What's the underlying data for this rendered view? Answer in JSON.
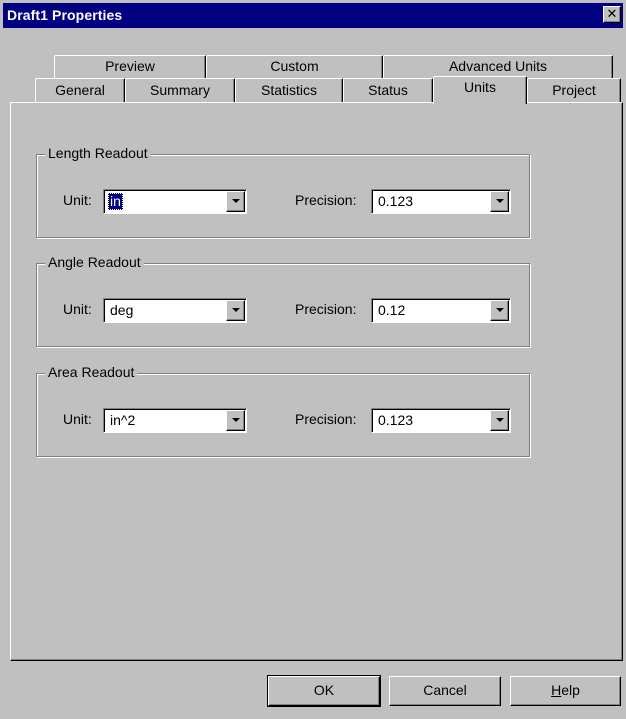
{
  "window": {
    "title": "Draft1 Properties",
    "close_glyph": "✕"
  },
  "tabs": {
    "row1": [
      "Preview",
      "Custom",
      "Advanced Units"
    ],
    "row2": [
      "General",
      "Summary",
      "Statistics",
      "Status",
      "Units",
      "Project"
    ],
    "active": "Units"
  },
  "groups": {
    "length": {
      "title": "Length Readout",
      "unit_label": "Unit:",
      "unit_value": "in",
      "precision_label": "Precision:",
      "precision_value": "0.123"
    },
    "angle": {
      "title": "Angle Readout",
      "unit_label": "Unit:",
      "unit_value": "deg",
      "precision_label": "Precision:",
      "precision_value": "0.12"
    },
    "area": {
      "title": "Area Readout",
      "unit_label": "Unit:",
      "unit_value": "in^2",
      "precision_label": "Precision:",
      "precision_value": "0.123"
    }
  },
  "buttons": {
    "ok": "OK",
    "cancel": "Cancel",
    "help_hotkey": "H",
    "help_rest": "elp"
  },
  "colors": {
    "titlebar": "#000080",
    "face": "#c0c0c0",
    "selection": "#000080"
  }
}
